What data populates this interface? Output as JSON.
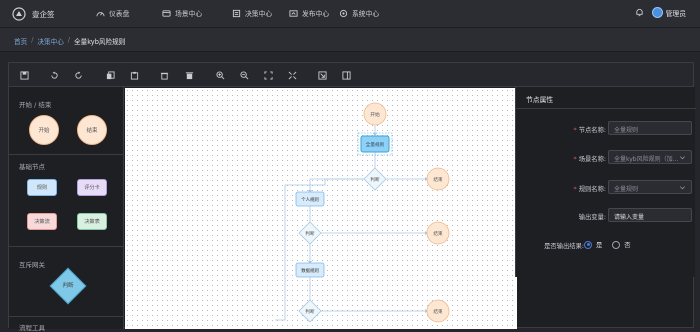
{
  "app": {
    "name": "壹企签"
  },
  "nav": [
    {
      "label": "仪表盘",
      "icon": "dashboard-icon"
    },
    {
      "label": "场景中心",
      "icon": "scene-icon"
    },
    {
      "label": "决策中心",
      "icon": "decision-icon"
    },
    {
      "label": "发布中心",
      "icon": "publish-icon"
    },
    {
      "label": "系统中心",
      "icon": "system-icon"
    }
  ],
  "user": {
    "name": "管理员"
  },
  "breadcrumb": {
    "home": "首页",
    "parent": "决策中心",
    "sep": "/",
    "current": "全量kyb风险规则"
  },
  "palette": {
    "section_start_end": "开始 / 结束",
    "start_node": "开始",
    "end_node": "结束",
    "section_basic": "基础节点",
    "node_rule": "规则",
    "node_score": "评分卡",
    "node_decision_flow": "决策流",
    "node_decision_table": "决策表",
    "section_branch": "互斥网关",
    "branch_node": "判断",
    "section_more": "流程工具"
  },
  "canvas": {
    "start": "开始",
    "rule_node": "全量规则",
    "branch1": "判断",
    "end1": "结束",
    "manual_node": "个人规则",
    "branch2": "判断",
    "end2": "结束",
    "table_node": "数据规则",
    "branch3": "判断",
    "end3": "结束"
  },
  "props": {
    "title": "节点属性",
    "node_name_label": "节点名称:",
    "node_name_value": "全量规则",
    "scene_label": "场景名称:",
    "scene_value": "全量kyb风险规则（加...",
    "rule_label": "规则名称:",
    "rule_value": "全量规则",
    "output_label": "输出变量:",
    "output_placeholder": "请输入变量",
    "result_label": "是否输出结果:",
    "result_yes": "是",
    "result_no": "否",
    "result_selected": "是"
  },
  "colors": {
    "accent": "#4a90e2",
    "start_fill": "#fde7d2",
    "node_blue": "#cfe6fb",
    "node_purple": "#e7dcf7",
    "node_pink": "#f8d9d9",
    "node_green": "#d7f0e1",
    "diamond": "#7ec8e8"
  }
}
